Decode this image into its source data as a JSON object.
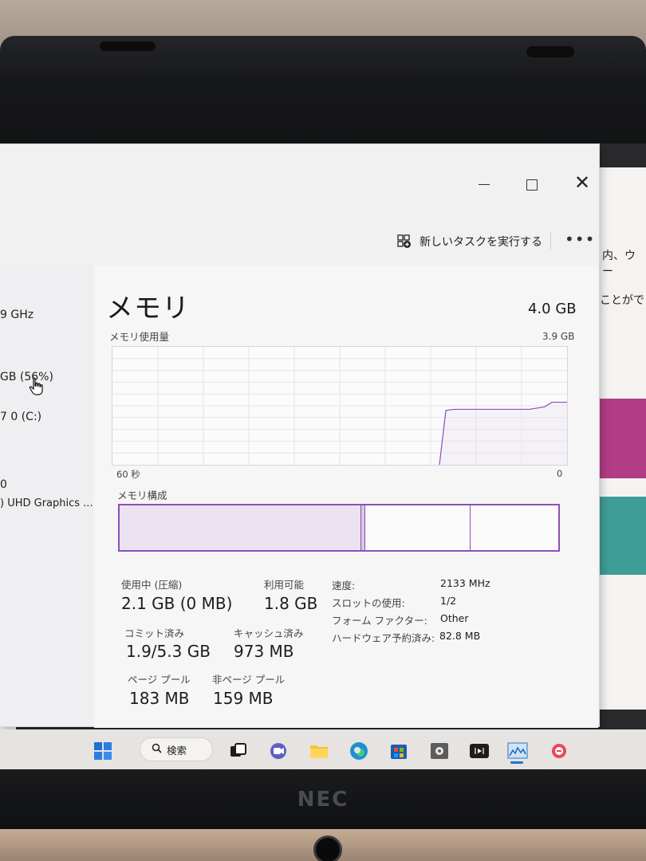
{
  "window": {
    "new_task_label": "新しいタスクを実行する",
    "more_label": "•••",
    "close_symbol": "✕"
  },
  "sidebar": {
    "cpu_speed": "9 GHz",
    "memory_usage": "GB (56%)",
    "disk": "7 0 (C:)",
    "gpu_index": "0",
    "gpu_name": ") UHD Graphics ..."
  },
  "background_app": {
    "text_line1": "内、ウー",
    "text_line2": "ことがで"
  },
  "memory": {
    "title": "メモリ",
    "total": "4.0 GB",
    "usage_label": "メモリ使用量",
    "graph_max": "3.9 GB",
    "axis_left": "60 秒",
    "axis_right": "0",
    "usage_fraction_history": [
      0.0,
      0.0,
      0.0,
      0.0,
      0.0,
      0.0,
      0.0,
      0.0,
      0.0,
      0.0,
      0.0,
      0.0,
      0.0,
      0.0,
      0.0,
      0.0,
      0.0,
      0.0,
      0.0,
      0.0,
      0.0,
      0.0,
      0.0,
      0.0,
      0.0,
      0.0,
      0.0,
      0.0,
      0.0,
      0.0,
      0.0,
      0.0,
      0.0,
      0.0,
      0.0,
      0.0,
      0.0,
      0.0,
      0.0,
      0.0,
      0.0,
      0.0,
      0.0,
      0.0,
      0.46,
      0.47,
      0.47,
      0.47,
      0.47,
      0.47,
      0.47,
      0.47,
      0.47,
      0.47,
      0.47,
      0.47,
      0.48,
      0.49,
      0.53,
      0.53,
      0.53
    ],
    "composition_label": "メモリ構成",
    "composition_fractions": {
      "in_use": 0.55,
      "modified": 0.01,
      "standby": 0.24,
      "free": 0.2
    },
    "stats": {
      "in_use_label": "使用中 (圧縮)",
      "in_use_value": "2.1 GB (0 MB)",
      "available_label": "利用可能",
      "available_value": "1.8 GB",
      "committed_label": "コミット済み",
      "committed_value": "1.9/5.3 GB",
      "cached_label": "キャッシュ済み",
      "cached_value": "973 MB",
      "paged_pool_label": "ページ プール",
      "paged_pool_value": "183 MB",
      "nonpaged_pool_label": "非ページ プール",
      "nonpaged_pool_value": "159 MB"
    },
    "properties": {
      "speed_label": "速度:",
      "speed_value": "2133 MHz",
      "slots_label": "スロットの使用:",
      "slots_value": "1/2",
      "form_factor_label": "フォーム ファクター:",
      "form_factor_value": "Other",
      "hw_reserved_label": "ハードウェア予約済み:",
      "hw_reserved_value": "82.8 MB"
    }
  },
  "taskbar": {
    "search_label": "検索"
  },
  "device": {
    "brand": "NEC"
  },
  "colors": {
    "memory_accent": "#8c4fb7",
    "memory_fill": "#e8e1ee",
    "grid": "#e6e2ec",
    "taskbar_bg": "#e6e3e0"
  }
}
